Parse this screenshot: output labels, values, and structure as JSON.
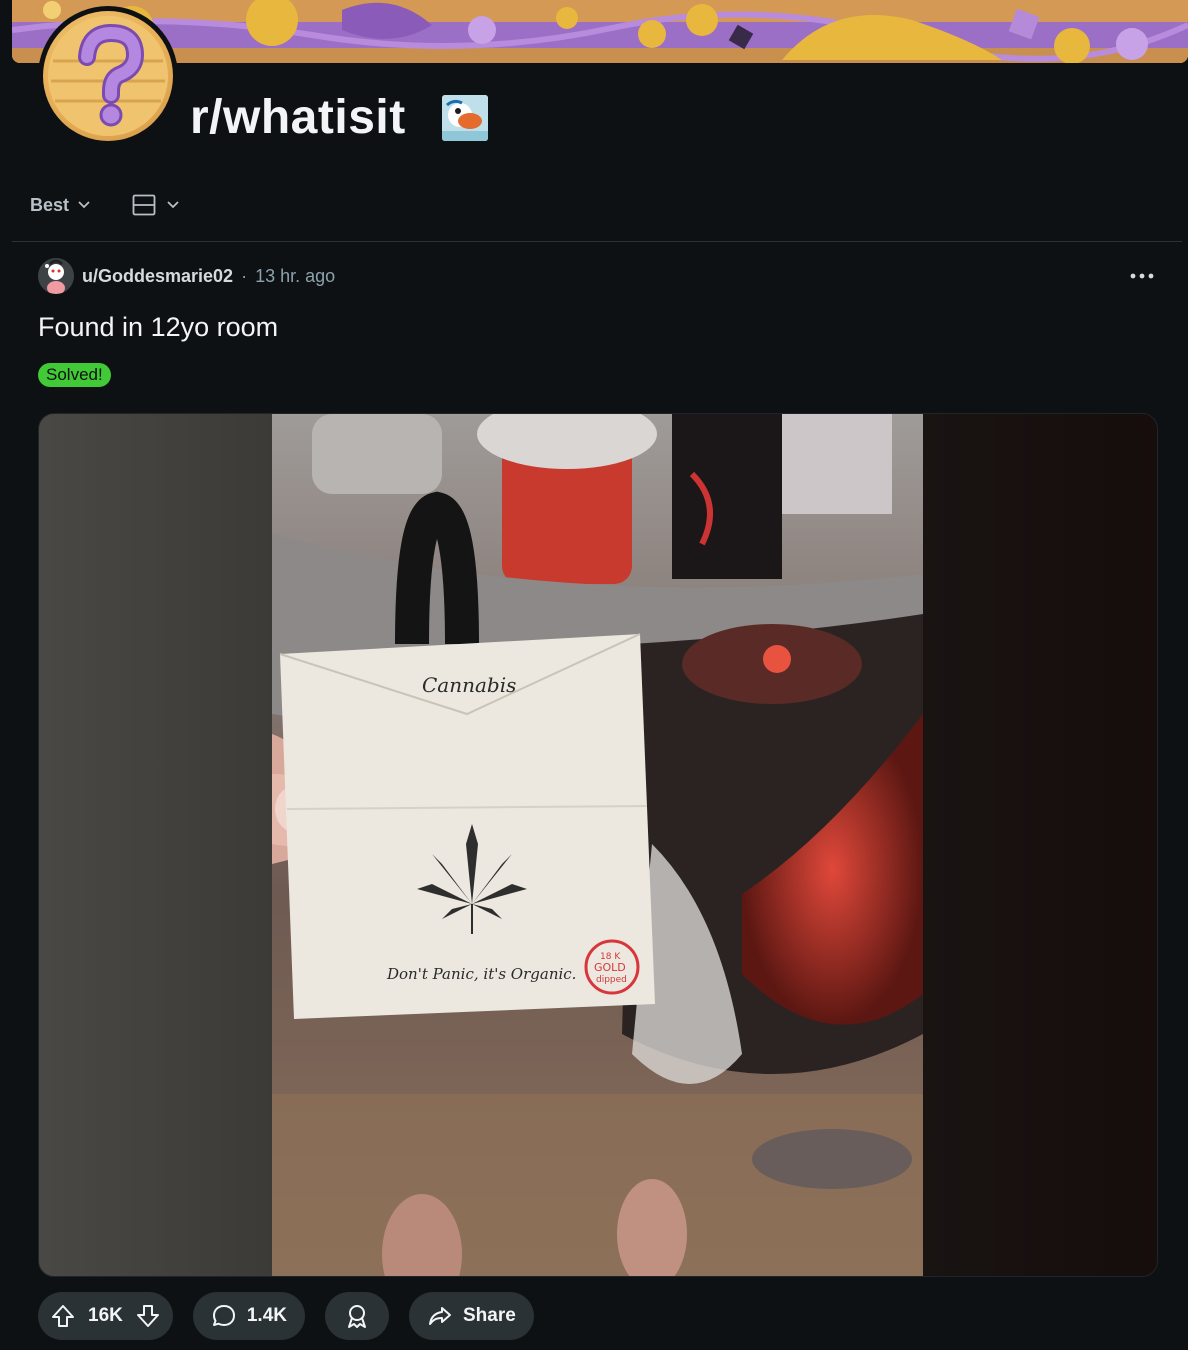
{
  "subreddit": {
    "name": "r/whatisit"
  },
  "sort": {
    "label": "Best"
  },
  "post": {
    "author": "u/Goddesmarie02",
    "separator": "·",
    "time": "13 hr. ago",
    "title": "Found in 12yo room",
    "flair": "Solved!",
    "card": {
      "heading": "Cannabis",
      "tagline": "Don't Panic, it's Organic.",
      "stamp_line1": "18 K",
      "stamp_line2": "GOLD",
      "stamp_line3": "dipped"
    }
  },
  "actions": {
    "upvotes": "16K",
    "comments": "1.4K",
    "share_label": "Share"
  },
  "colors": {
    "background": "#0e1113",
    "flair": "#41c936",
    "pill": "#2a3236"
  }
}
